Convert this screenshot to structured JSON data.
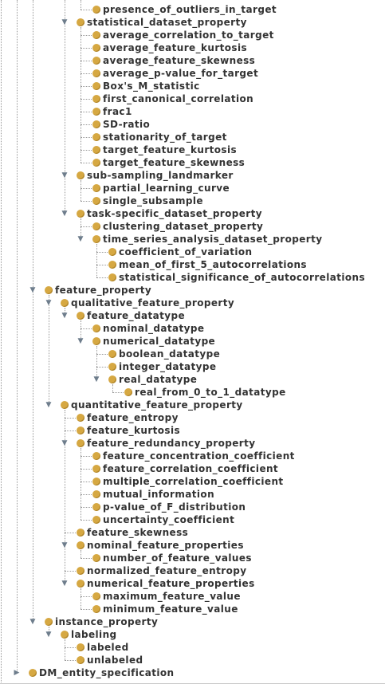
{
  "tree": {
    "nodes": [
      {
        "label": "presence_of_outliers_in_target",
        "depth": 3,
        "expander": "none"
      },
      {
        "label": "statistical_dataset_property",
        "depth": 2,
        "expander": "expanded"
      },
      {
        "label": "average_correlation_to_target",
        "depth": 3,
        "expander": "none"
      },
      {
        "label": "average_feature_kurtosis",
        "depth": 3,
        "expander": "none"
      },
      {
        "label": "average_feature_skewness",
        "depth": 3,
        "expander": "none"
      },
      {
        "label": "average_p-value_for_target",
        "depth": 3,
        "expander": "none"
      },
      {
        "label": "Box's_M_statistic",
        "depth": 3,
        "expander": "none"
      },
      {
        "label": "first_canonical_correlation",
        "depth": 3,
        "expander": "none"
      },
      {
        "label": "frac1",
        "depth": 3,
        "expander": "none"
      },
      {
        "label": "SD-ratio",
        "depth": 3,
        "expander": "none"
      },
      {
        "label": "stationarity_of_target",
        "depth": 3,
        "expander": "none"
      },
      {
        "label": "target_feature_kurtosis",
        "depth": 3,
        "expander": "none"
      },
      {
        "label": "target_feature_skewness",
        "depth": 3,
        "expander": "none"
      },
      {
        "label": "sub-sampling_landmarker",
        "depth": 2,
        "expander": "expanded"
      },
      {
        "label": "partial_learning_curve",
        "depth": 3,
        "expander": "none"
      },
      {
        "label": "single_subsample",
        "depth": 3,
        "expander": "none"
      },
      {
        "label": "task-specific_dataset_property",
        "depth": 2,
        "expander": "expanded"
      },
      {
        "label": "clustering_dataset_property",
        "depth": 3,
        "expander": "none"
      },
      {
        "label": "time_series_analysis_dataset_property",
        "depth": 3,
        "expander": "expanded"
      },
      {
        "label": "coefficient_of_variation",
        "depth": 4,
        "expander": "none"
      },
      {
        "label": "mean_of_first_5_autocorrelations",
        "depth": 4,
        "expander": "none"
      },
      {
        "label": "statistical_significance_of_autocorrelations",
        "depth": 4,
        "expander": "none"
      },
      {
        "label": "feature_property",
        "depth": 0,
        "expander": "expanded"
      },
      {
        "label": "qualitative_feature_property",
        "depth": 1,
        "expander": "expanded"
      },
      {
        "label": "feature_datatype",
        "depth": 2,
        "expander": "expanded"
      },
      {
        "label": "nominal_datatype",
        "depth": 3,
        "expander": "none"
      },
      {
        "label": "numerical_datatype",
        "depth": 3,
        "expander": "expanded"
      },
      {
        "label": "boolean_datatype",
        "depth": 4,
        "expander": "none"
      },
      {
        "label": "integer_datatype",
        "depth": 4,
        "expander": "none"
      },
      {
        "label": "real_datatype",
        "depth": 4,
        "expander": "expanded"
      },
      {
        "label": "real_from_0_to_1_datatype",
        "depth": 5,
        "expander": "none"
      },
      {
        "label": "quantitative_feature_property",
        "depth": 1,
        "expander": "expanded"
      },
      {
        "label": "feature_entropy",
        "depth": 2,
        "expander": "none"
      },
      {
        "label": "feature_kurtosis",
        "depth": 2,
        "expander": "none"
      },
      {
        "label": "feature_redundancy_property",
        "depth": 2,
        "expander": "expanded"
      },
      {
        "label": "feature_concentration_coefficient",
        "depth": 3,
        "expander": "none"
      },
      {
        "label": "feature_correlation_coefficient",
        "depth": 3,
        "expander": "none"
      },
      {
        "label": "multiple_correlation_coefficient",
        "depth": 3,
        "expander": "none"
      },
      {
        "label": "mutual_information",
        "depth": 3,
        "expander": "none"
      },
      {
        "label": "p-value_of_F_distribution",
        "depth": 3,
        "expander": "none"
      },
      {
        "label": "uncertainty_coefficient",
        "depth": 3,
        "expander": "none"
      },
      {
        "label": "feature_skewness",
        "depth": 2,
        "expander": "none"
      },
      {
        "label": "nominal_feature_properties",
        "depth": 2,
        "expander": "expanded"
      },
      {
        "label": "number_of_feature_values",
        "depth": 3,
        "expander": "none"
      },
      {
        "label": "normalized_feature_entropy",
        "depth": 2,
        "expander": "none"
      },
      {
        "label": "numerical_feature_properties",
        "depth": 2,
        "expander": "expanded"
      },
      {
        "label": "maximum_feature_value",
        "depth": 3,
        "expander": "none"
      },
      {
        "label": "minimum_feature_value",
        "depth": 3,
        "expander": "none"
      },
      {
        "label": "instance_property",
        "depth": 0,
        "expander": "expanded"
      },
      {
        "label": "labeling",
        "depth": 1,
        "expander": "expanded"
      },
      {
        "label": "labeled",
        "depth": 2,
        "expander": "none"
      },
      {
        "label": "unlabeled",
        "depth": 2,
        "expander": "none"
      },
      {
        "label": "DM_entity_specification",
        "depth": -1,
        "expander": "collapsed"
      }
    ]
  },
  "icons": {
    "class_node": "class-bullet-icon",
    "expanded": "triangle-down-icon",
    "collapsed": "triangle-right-icon"
  },
  "colors": {
    "class_bullet": "#d6a842",
    "expander": "#6e7d8c",
    "text": "#333333",
    "tree_lines": "#9a9a9a"
  }
}
